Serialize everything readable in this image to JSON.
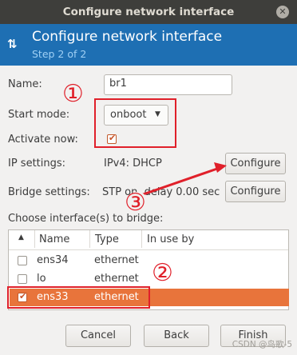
{
  "window": {
    "title": "Configure network interface",
    "close_glyph": "✕"
  },
  "header": {
    "title": "Configure network interface",
    "step": "Step 2 of 2",
    "icon": "network-arrows-icon"
  },
  "form": {
    "name_label": "Name:",
    "name_value": "br1",
    "start_mode_label": "Start mode:",
    "start_mode_value": "onboot",
    "activate_label": "Activate now:",
    "activate_checked": true,
    "ip_label": "IP settings:",
    "ip_value": "IPv4: DHCP",
    "ip_configure": "Configure",
    "bridge_label": "Bridge settings:",
    "bridge_value": "STP on, delay 0.00 sec",
    "bridge_configure": "Configure",
    "choose_label": "Choose interface(s) to bridge:"
  },
  "table": {
    "columns": [
      "Name",
      "Type",
      "In use by"
    ],
    "rows": [
      {
        "checked": false,
        "name": "ens34",
        "type": "ethernet",
        "in_use_by": ""
      },
      {
        "checked": false,
        "name": "lo",
        "type": "ethernet",
        "in_use_by": ""
      },
      {
        "checked": true,
        "name": "ens33",
        "type": "ethernet",
        "in_use_by": "",
        "selected": true
      }
    ]
  },
  "buttons": {
    "cancel": "Cancel",
    "back": "Back",
    "finish": "Finish"
  },
  "annotations": {
    "one": "①",
    "two": "②",
    "three": "③",
    "annotation_color": "#e0202a"
  },
  "watermark": "CSDN @鸟歌-5",
  "colors": {
    "header": "#1e6fb3",
    "selection": "#e8743b",
    "titlebar": "#3e3e3b"
  }
}
